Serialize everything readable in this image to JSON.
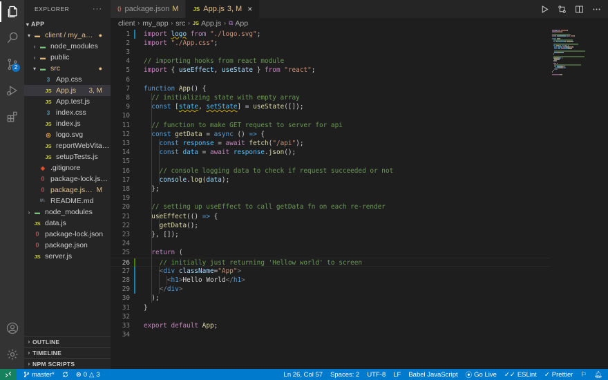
{
  "explorer": {
    "title": "EXPLORER",
    "more": "···",
    "root": "APP",
    "tree": [
      {
        "label": "client / my_a…",
        "depth": 1,
        "chev": "down",
        "icon": "folder",
        "status": "dot",
        "modified": true
      },
      {
        "label": "node_modules",
        "depth": 2,
        "chev": "right",
        "icon": "folder-node"
      },
      {
        "label": "public",
        "depth": 2,
        "chev": "right",
        "icon": "folder"
      },
      {
        "label": "src",
        "depth": 2,
        "chev": "down",
        "icon": "folder-src",
        "status": "dot",
        "modified": true
      },
      {
        "label": "App.css",
        "depth": 3,
        "icon": "css"
      },
      {
        "label": "App.js",
        "depth": 3,
        "icon": "js",
        "status": "3, M",
        "modified": true,
        "selected": true
      },
      {
        "label": "App.test.js",
        "depth": 3,
        "icon": "js"
      },
      {
        "label": "index.css",
        "depth": 3,
        "icon": "css"
      },
      {
        "label": "index.js",
        "depth": 3,
        "icon": "js"
      },
      {
        "label": "logo.svg",
        "depth": 3,
        "icon": "svg"
      },
      {
        "label": "reportWebVita…",
        "depth": 3,
        "icon": "js"
      },
      {
        "label": "setupTests.js",
        "depth": 3,
        "icon": "js"
      },
      {
        "label": ".gitignore",
        "depth": 2,
        "icon": "git"
      },
      {
        "label": "package-lock.js…",
        "depth": 2,
        "icon": "json"
      },
      {
        "label": "package.js…",
        "depth": 2,
        "icon": "json",
        "status": "M",
        "modified": true
      },
      {
        "label": "README.md",
        "depth": 2,
        "icon": "md"
      },
      {
        "label": "node_modules",
        "depth": 1,
        "chev": "right",
        "icon": "folder-node"
      },
      {
        "label": "data.js",
        "depth": 1,
        "icon": "js"
      },
      {
        "label": "package-lock.json",
        "depth": 1,
        "icon": "json"
      },
      {
        "label": "package.json",
        "depth": 1,
        "icon": "json"
      },
      {
        "label": "server.js",
        "depth": 1,
        "icon": "js"
      }
    ],
    "sections": [
      "OUTLINE",
      "TIMELINE",
      "NPM SCRIPTS"
    ]
  },
  "icon_glyphs": {
    "js": "JS",
    "css": "3",
    "json": "{}",
    "md": "M↓",
    "git": "◆",
    "svg": "◎",
    "folder": "▬",
    "folder-node": "▬",
    "folder-src": "▬"
  },
  "tabs": [
    {
      "label": "package.json",
      "status": "M",
      "icon": "json",
      "active": false
    },
    {
      "label": "App.js",
      "status": "3, M",
      "icon": "js",
      "active": true
    }
  ],
  "breadcrumb": [
    "client",
    "my_app",
    "src",
    "App.js",
    "App"
  ],
  "editor": {
    "current_line": 26,
    "lines": [
      [
        [
          "import ",
          "k"
        ],
        [
          "logo",
          "v sq"
        ],
        [
          " from ",
          "k"
        ],
        [
          "\"./logo.svg\"",
          "s"
        ],
        [
          ";",
          ""
        ]
      ],
      [
        [
          "import ",
          "k"
        ],
        [
          "\"./App.css\"",
          "s"
        ],
        [
          ";",
          ""
        ]
      ],
      [],
      [
        [
          "// importing hooks from react module",
          "c"
        ]
      ],
      [
        [
          "import ",
          "k"
        ],
        [
          "{ ",
          ""
        ],
        [
          "useEffect",
          "v"
        ],
        [
          ", ",
          ""
        ],
        [
          "useState",
          "v"
        ],
        [
          " } ",
          ""
        ],
        [
          "from ",
          "k"
        ],
        [
          "\"react\"",
          "s"
        ],
        [
          ";",
          ""
        ]
      ],
      [],
      [
        [
          "function ",
          "kb"
        ],
        [
          "App",
          "f"
        ],
        [
          "() {",
          ""
        ]
      ],
      [
        [
          "  // initializing state with empty array",
          "c"
        ]
      ],
      [
        [
          "  ",
          ""
        ],
        [
          "const ",
          "kb"
        ],
        [
          "[",
          ""
        ],
        [
          "state",
          "cst sq"
        ],
        [
          ", ",
          ""
        ],
        [
          "setState",
          "cst sq"
        ],
        [
          "] = ",
          ""
        ],
        [
          "useState",
          "f"
        ],
        [
          "([]);",
          ""
        ]
      ],
      [],
      [
        [
          "  // function to make GET request to server for api",
          "c"
        ]
      ],
      [
        [
          "  ",
          ""
        ],
        [
          "const ",
          "kb"
        ],
        [
          "getData",
          "f"
        ],
        [
          " = ",
          ""
        ],
        [
          "async ",
          "kb"
        ],
        [
          "() ",
          ""
        ],
        [
          "=>",
          "kb"
        ],
        [
          " {",
          ""
        ]
      ],
      [
        [
          "    ",
          ""
        ],
        [
          "const ",
          "kb"
        ],
        [
          "response",
          "cst"
        ],
        [
          " = ",
          ""
        ],
        [
          "await ",
          "k"
        ],
        [
          "fetch",
          "f"
        ],
        [
          "(",
          ""
        ],
        [
          "\"/api\"",
          "s"
        ],
        [
          ");",
          ""
        ]
      ],
      [
        [
          "    ",
          ""
        ],
        [
          "const ",
          "kb"
        ],
        [
          "data",
          "cst"
        ],
        [
          " = ",
          ""
        ],
        [
          "await ",
          "k"
        ],
        [
          "response",
          "cst"
        ],
        [
          ".",
          ""
        ],
        [
          "json",
          "f"
        ],
        [
          "();",
          ""
        ]
      ],
      [],
      [
        [
          "    // console logging data to check if request succeeded or not",
          "c"
        ]
      ],
      [
        [
          "    ",
          ""
        ],
        [
          "console",
          "v"
        ],
        [
          ".",
          ""
        ],
        [
          "log",
          "f"
        ],
        [
          "(",
          ""
        ],
        [
          "data",
          "v"
        ],
        [
          ");",
          ""
        ]
      ],
      [
        [
          "  };",
          ""
        ]
      ],
      [],
      [
        [
          "  // setting up useEffect to call getData fn on each re-render",
          "c"
        ]
      ],
      [
        [
          "  ",
          ""
        ],
        [
          "useEffect",
          "f"
        ],
        [
          "(() ",
          ""
        ],
        [
          "=>",
          "kb"
        ],
        [
          " {",
          ""
        ]
      ],
      [
        [
          "    ",
          ""
        ],
        [
          "getData",
          "f"
        ],
        [
          "();",
          ""
        ]
      ],
      [
        [
          "  }, []);",
          ""
        ]
      ],
      [],
      [
        [
          "  ",
          ""
        ],
        [
          "return ",
          "k"
        ],
        [
          "(",
          ""
        ]
      ],
      [
        [
          "    // initially just returning 'Hellow world' to screen",
          "c"
        ]
      ],
      [
        [
          "    ",
          ""
        ],
        [
          "<",
          "pun"
        ],
        [
          "div ",
          "tag"
        ],
        [
          "className",
          "attr"
        ],
        [
          "=",
          ""
        ],
        [
          "\"App\"",
          "s"
        ],
        [
          ">",
          "pun"
        ]
      ],
      [
        [
          "      ",
          ""
        ],
        [
          "<",
          "pun"
        ],
        [
          "h1",
          "tag"
        ],
        [
          ">",
          "pun"
        ],
        [
          "Hello World",
          ""
        ],
        [
          "</",
          "pun"
        ],
        [
          "h1",
          "tag"
        ],
        [
          ">",
          "pun"
        ]
      ],
      [
        [
          "    ",
          ""
        ],
        [
          "</",
          "pun"
        ],
        [
          "div",
          "tag"
        ],
        [
          ">",
          "pun"
        ]
      ],
      [
        [
          "  );",
          ""
        ]
      ],
      [
        [
          "}",
          ""
        ]
      ],
      [],
      [
        [
          "export ",
          "k"
        ],
        [
          "default ",
          "k"
        ],
        [
          "App",
          "f"
        ],
        [
          ";",
          ""
        ]
      ],
      []
    ]
  },
  "status": {
    "branch": "master*",
    "errors": "0",
    "warnings": "3",
    "position": "Ln 26, Col 57",
    "spaces": "Spaces: 2",
    "encoding": "UTF-8",
    "eol": "LF",
    "language": "Babel JavaScript",
    "golive": "Go Live",
    "eslint": "ESLint",
    "prettier": "Prettier"
  },
  "colors": {
    "accent": "#007acc",
    "modified": "#e2c08d",
    "remote": "#16825d"
  }
}
